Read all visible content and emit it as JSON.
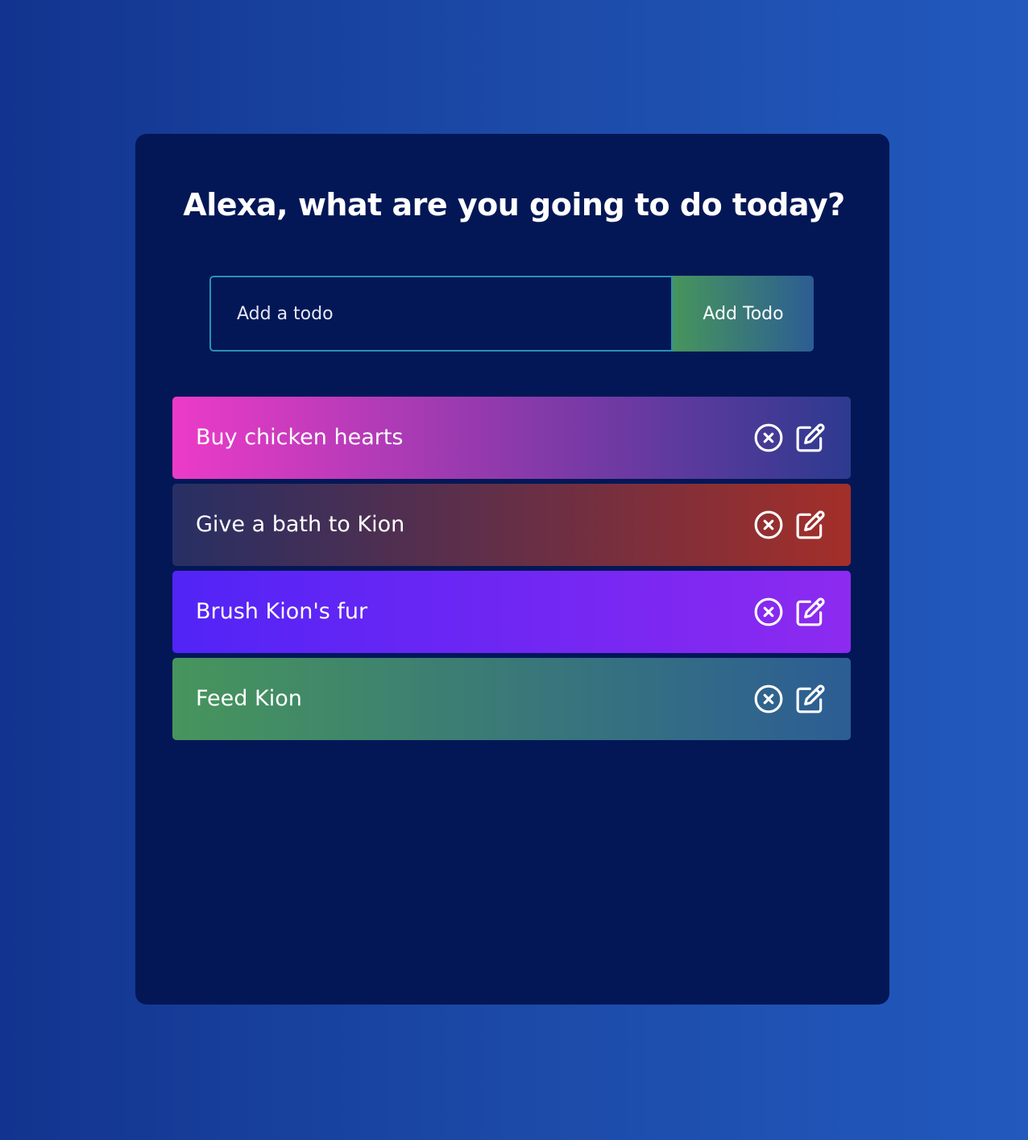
{
  "header": {
    "title": "Alexa, what are you going to do today?"
  },
  "form": {
    "placeholder": "Add a todo",
    "value": "",
    "button_label": "Add Todo",
    "button_gradient": [
      "#47955c",
      "#2c5d94"
    ],
    "input_border_color": "#2b8fb8"
  },
  "todos": [
    {
      "text": "Buy chicken hearts",
      "gradient": [
        "#ec3bc8",
        "#2d3a8f"
      ],
      "actions": [
        "close-circle-icon",
        "edit-icon"
      ]
    },
    {
      "text": "Give a bath to Kion",
      "gradient": [
        "#272f64",
        "#a32f29"
      ],
      "actions": [
        "close-circle-icon",
        "edit-icon"
      ]
    },
    {
      "text": "Brush Kion's fur",
      "gradient": [
        "#5224f6",
        "#8d2af0"
      ],
      "actions": [
        "close-circle-icon",
        "edit-icon"
      ]
    },
    {
      "text": "Feed Kion",
      "gradient": [
        "#47955c",
        "#2c5d94"
      ],
      "actions": [
        "close-circle-icon",
        "edit-icon"
      ]
    }
  ],
  "colors": {
    "page_background": [
      "#12348f",
      "#2259bd"
    ],
    "card_background": "#031756",
    "text": "#ffffff"
  }
}
